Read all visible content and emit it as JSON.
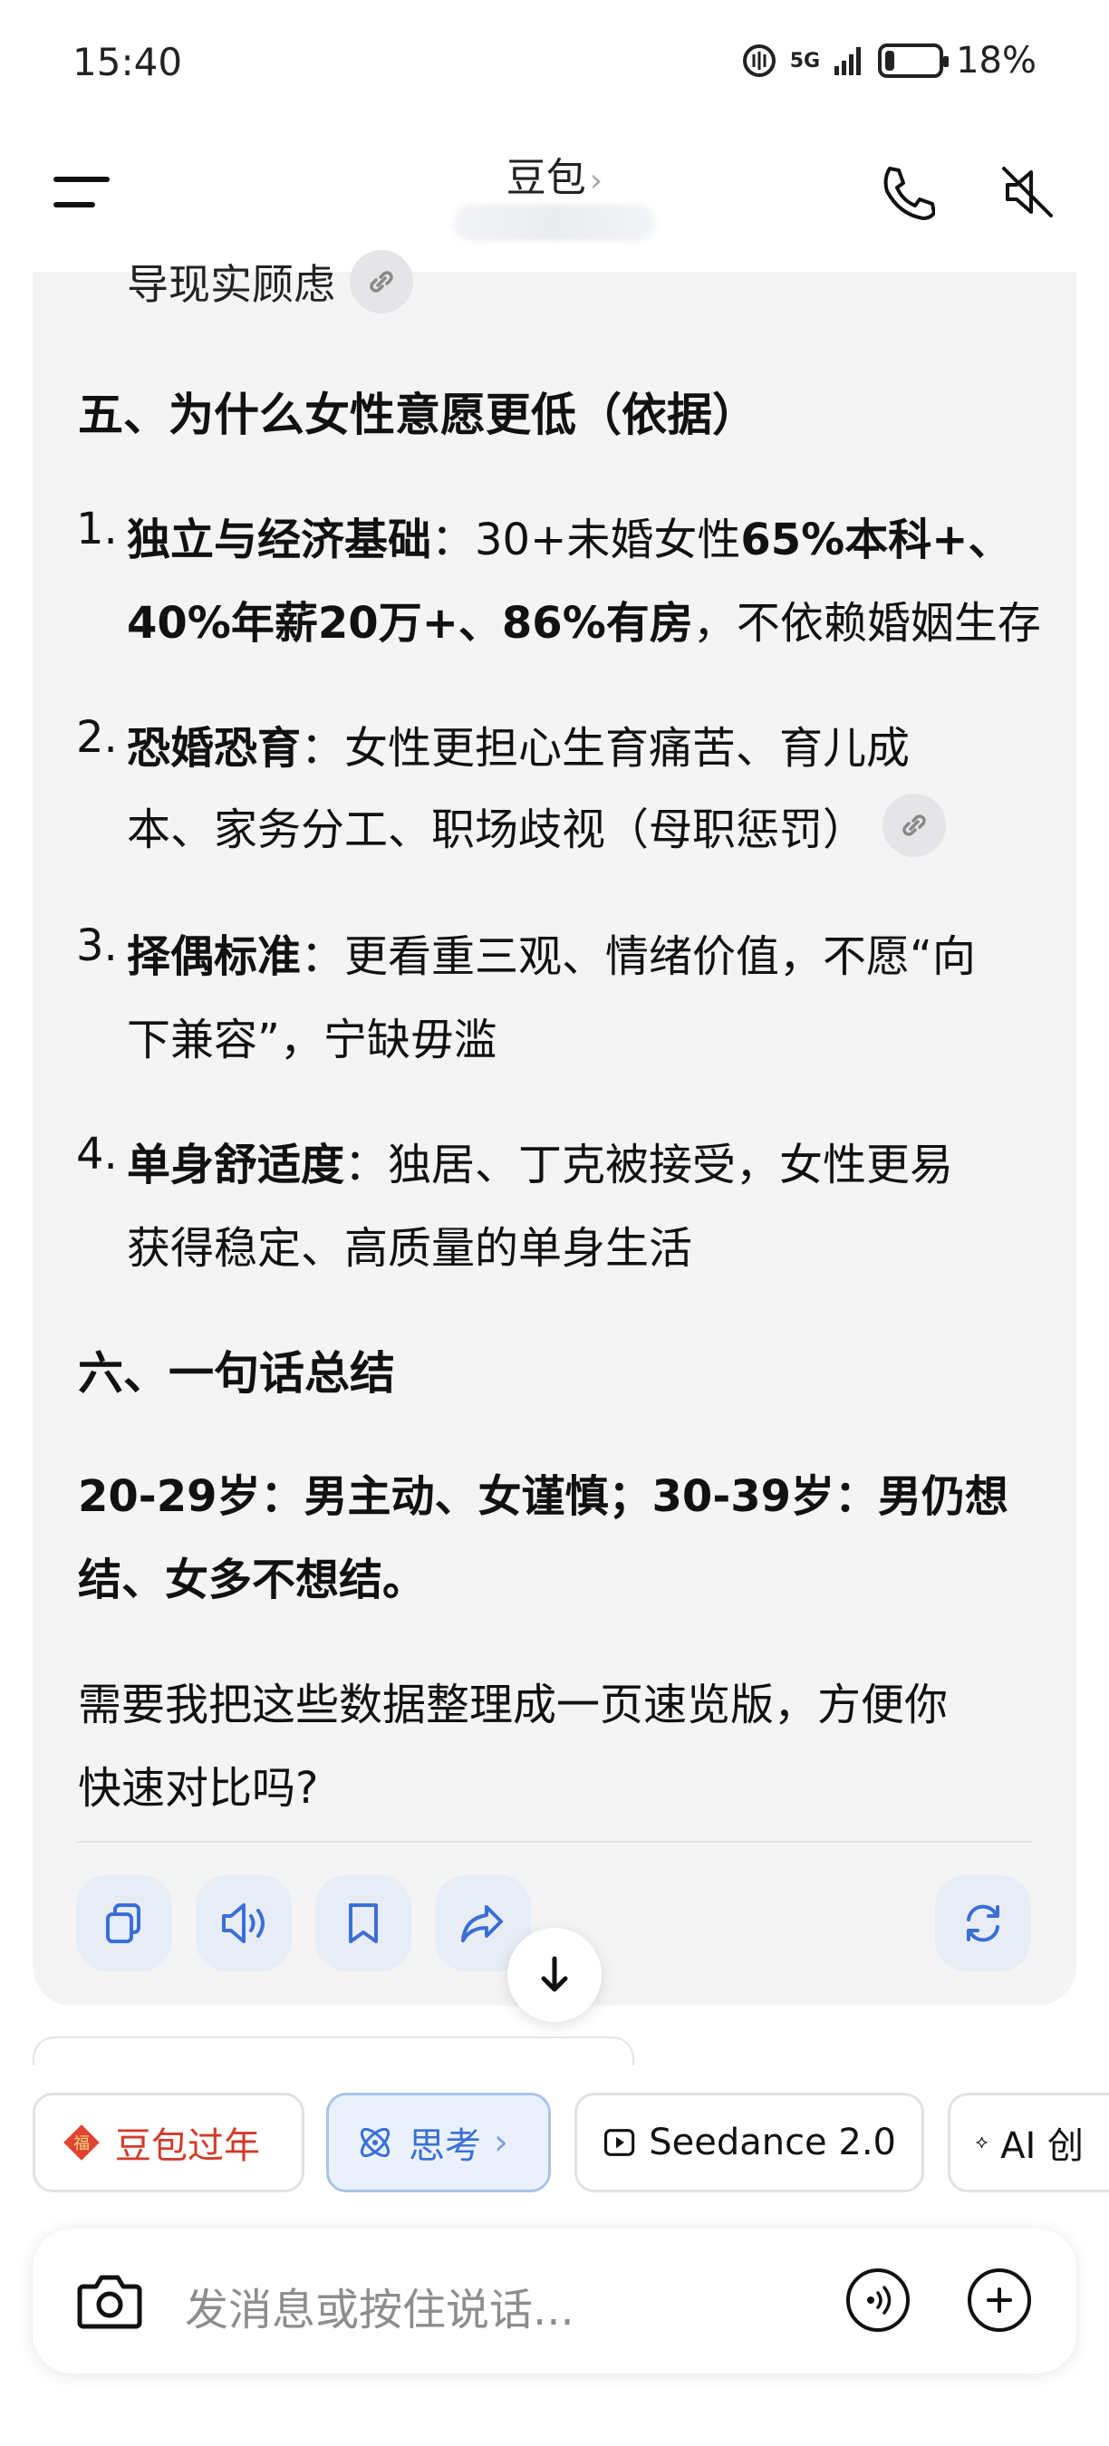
{
  "status_bar": {
    "time": "15:40",
    "network": "5G",
    "battery": "18%",
    "battery_level": 0.18
  },
  "header": {
    "title": "豆包",
    "title_chevron": "›"
  },
  "chat": {
    "clipped_line": "导现实顾虑",
    "section5_heading": "五、为什么女性意愿更低（依据）",
    "list": [
      {
        "num": "1.",
        "line1_bold": "独立与经济基础",
        "line1_rest": "：30+未婚女性",
        "line1_bold2": "65%本科+、",
        "line2_bold": "40%年薪20万+、86%有房",
        "line2_rest": "，不依赖婚姻生存"
      },
      {
        "num": "2.",
        "line1_bold": "恐婚恐育",
        "line1_rest": "：女性更担心生育痛苦、育儿成",
        "line2": "本、家务分工、职场歧视（母职惩罚）"
      },
      {
        "num": "3.",
        "line1_bold": "择偶标准",
        "line1_rest": "：更看重三观、情绪价值，不愿“向",
        "line2": "下兼容”，宁缺毋滥"
      },
      {
        "num": "4.",
        "line1_bold": "单身舒适度",
        "line1_rest": "：独居、丁克被接受，女性更易",
        "line2": "获得稳定、高质量的单身生活"
      }
    ],
    "section6_heading": "六、一句话总结",
    "summary_line1": "20-29岁：男主动、女谨慎；30-39岁：男仍想",
    "summary_line2": "结、女多不想结。",
    "question_line1": "需要我把这些数据整理成一页速览版，方便你",
    "question_line2": "快速对比吗?"
  },
  "actions": {
    "icons": [
      "copy-icon",
      "speaker-icon",
      "bookmark-icon",
      "share-icon",
      "regenerate-icon"
    ]
  },
  "chips": [
    {
      "label": "豆包过年",
      "icon": "fu-icon"
    },
    {
      "label": "思考",
      "chevron": "›",
      "icon": "atom-icon"
    },
    {
      "label": "Seedance 2.0",
      "icon": "play-icon"
    },
    {
      "label": "AI 创",
      "icon": "sparkle-icon"
    }
  ],
  "input": {
    "placeholder": "发消息或按住说话..."
  },
  "colors": {
    "accent": "#3a6fd8",
    "festival_red": "#d23a2a",
    "card_bg": "#f4f4f5"
  }
}
